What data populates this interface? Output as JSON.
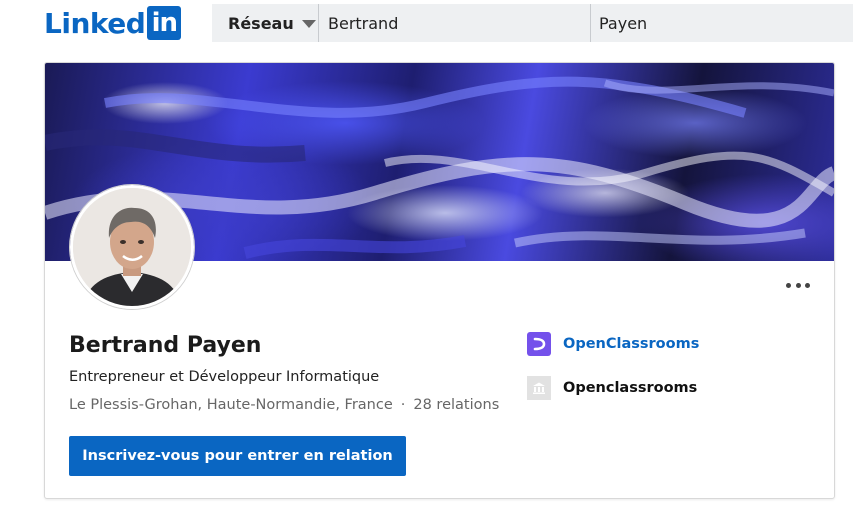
{
  "brand": {
    "logo_text": "Linked",
    "logo_box_text": "in",
    "color": "#0a66c2"
  },
  "search": {
    "category_label": "Réseau",
    "first_name": "Bertrand",
    "last_name": "Payen"
  },
  "profile": {
    "name": "Bertrand Payen",
    "headline": "Entrepreneur et Développeur Informatique",
    "location": "Le Plessis-Grohan, Haute-Normandie, France",
    "separator": "·",
    "relations": "28 relations",
    "cta_label": "Inscrivez-vous pour entrer en relation"
  },
  "organizations": [
    {
      "name": "OpenClassrooms",
      "icon": "openclassrooms-logo-icon",
      "color": "#7451eb",
      "link": true
    },
    {
      "name": "Openclassrooms",
      "icon": "school-building-icon",
      "link": false
    }
  ],
  "colors": {
    "accent": "#0a66c2",
    "search_bg": "#eef0f2",
    "muted_text": "#666666"
  }
}
